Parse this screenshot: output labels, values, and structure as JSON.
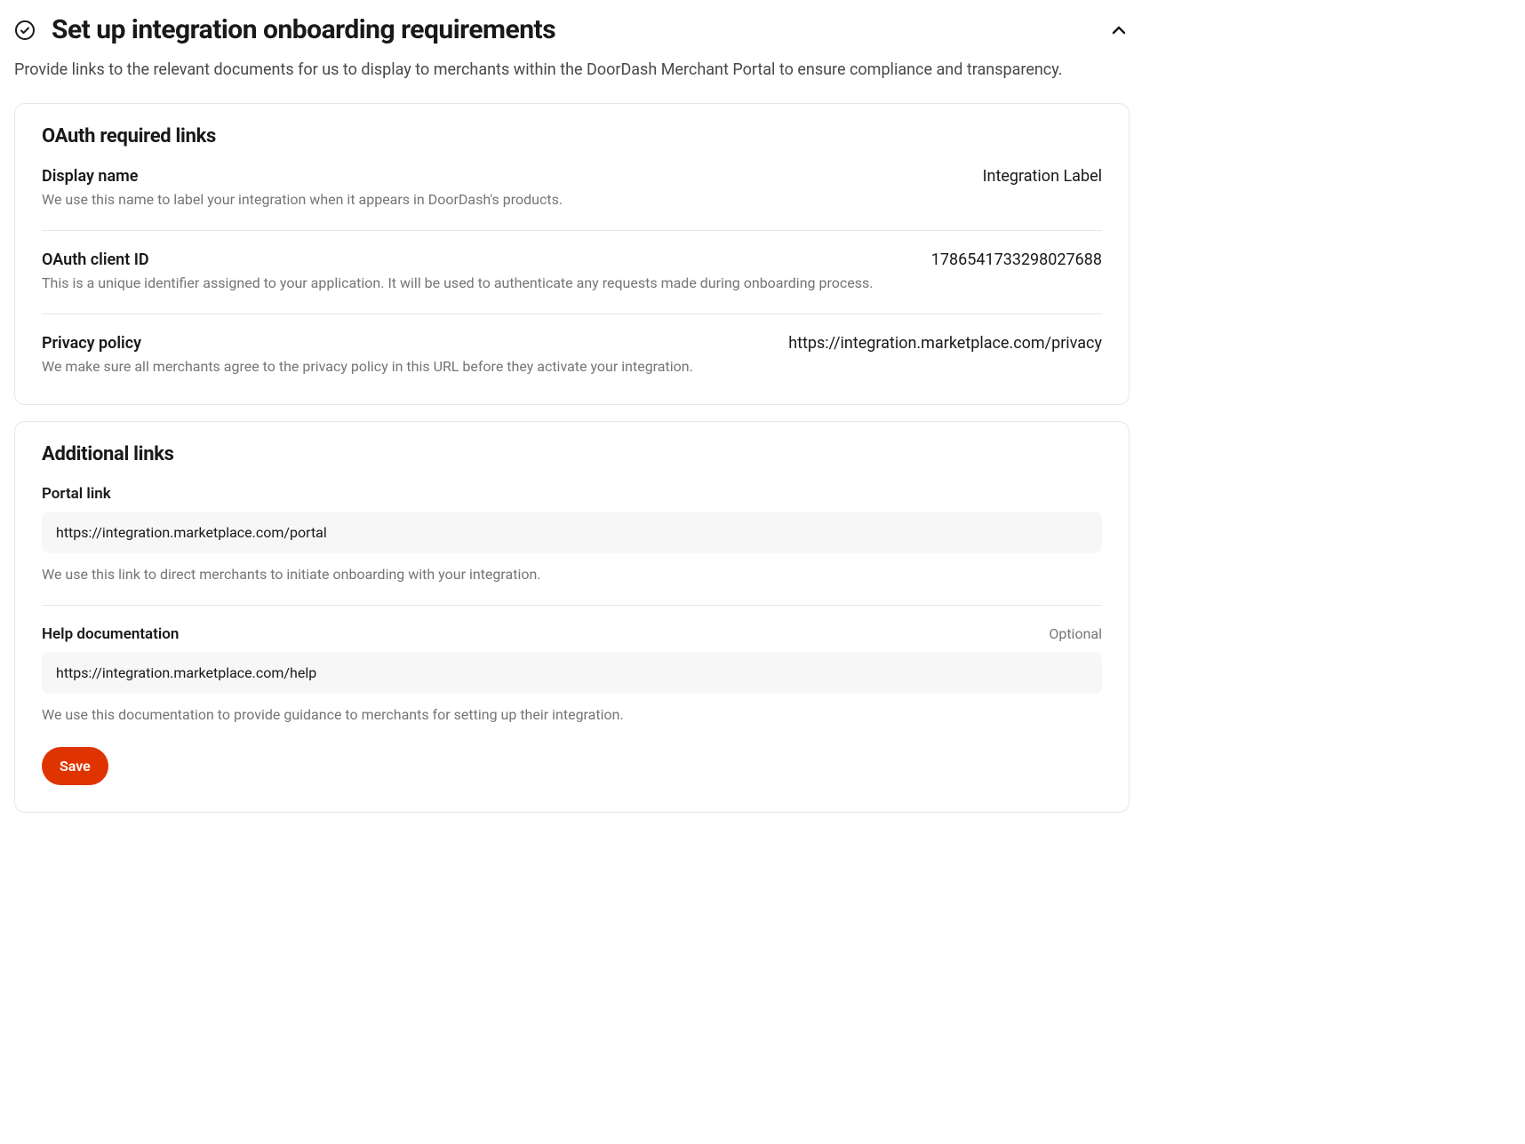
{
  "header": {
    "title": "Set up integration onboarding requirements",
    "description": "Provide links to the relevant documents for us to display to merchants within the DoorDash Merchant Portal to ensure compliance and transparency."
  },
  "oauth_section": {
    "title": "OAuth required links",
    "fields": {
      "display_name": {
        "label": "Display name",
        "description": "We use this name to label your integration when it appears in DoorDash's products.",
        "value": "Integration Label"
      },
      "client_id": {
        "label": "OAuth client ID",
        "description": "This is a unique identifier assigned to your application. It will be used to authenticate any requests made during onboarding process.",
        "value": "1786541733298027688"
      },
      "privacy_policy": {
        "label": "Privacy policy",
        "description": "We make sure all merchants agree to the privacy policy in this URL before they activate your integration.",
        "value": "https://integration.marketplace.com/privacy"
      }
    }
  },
  "additional_section": {
    "title": "Additional links",
    "portal_link": {
      "label": "Portal link",
      "value": "https://integration.marketplace.com/portal",
      "help": "We use this link to direct merchants to initiate onboarding with your integration."
    },
    "help_docs": {
      "label": "Help documentation",
      "optional": "Optional",
      "value": "https://integration.marketplace.com/help",
      "help": "We use this documentation to provide guidance to merchants for setting up their integration."
    },
    "save_label": "Save"
  }
}
